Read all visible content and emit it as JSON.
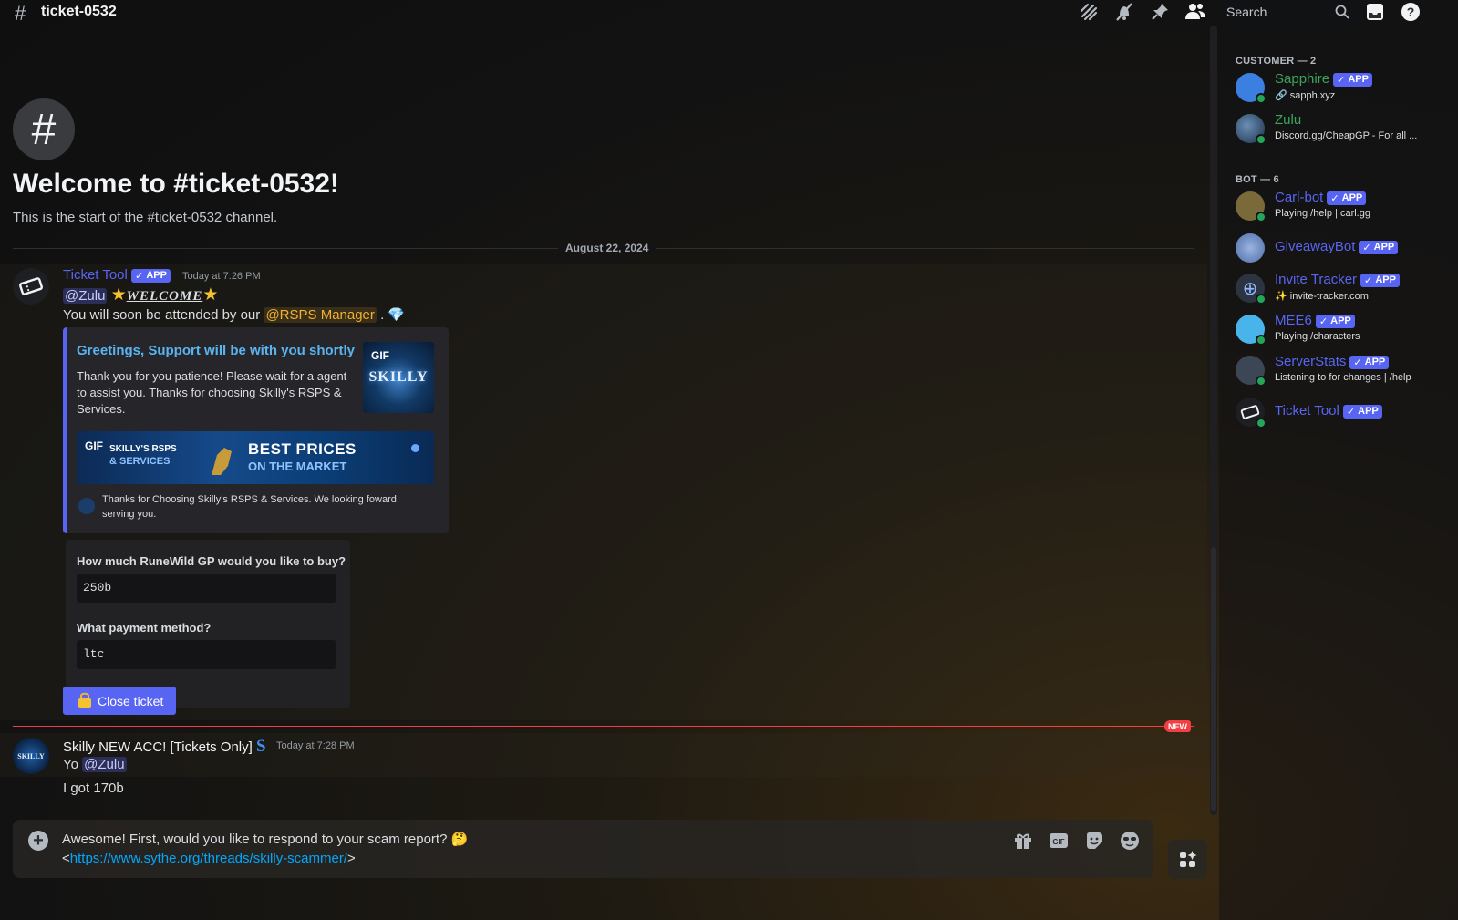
{
  "header": {
    "channel_name": "ticket-0532",
    "search_placeholder": "Search"
  },
  "intro": {
    "title": "Welcome to #ticket-0532!",
    "subtitle": "This is the start of the #ticket-0532 channel.",
    "date_divider": "August 22, 2024"
  },
  "message1": {
    "author": "Ticket Tool",
    "badge": "APP",
    "timestamp": "Today at 7:26 PM",
    "line1_mention": "@Zulu",
    "line1_welcome": "WELCOME",
    "line2_prefix": "You will soon be attended by our",
    "line2_role": "@RSPS Manager",
    "line2_suffix": ".",
    "embed": {
      "title": "Greetings, Support will be with you shortly",
      "description": "Thank you for you patience! Please wait for a agent to assist you. Thanks for choosing Skilly's RSPS & Services.",
      "thumb_gif_label": "GIF",
      "thumb_text": "SKILLY",
      "banner_gif_label": "GIF",
      "banner_left_line1": "SKILLY'S RSPS",
      "banner_left_line2": "& SERVICES",
      "banner_right_line1": "BEST PRICES",
      "banner_right_line2": "ON THE MARKET",
      "footer": "Thanks for Choosing Skilly's RSPS & Services. We looking foward serving you."
    },
    "form": {
      "q1": "How much RuneWild GP would you like to buy?",
      "a1": "250b",
      "q2": "What payment method?",
      "a2": "ltc"
    },
    "close_button": "Close ticket"
  },
  "new_badge": "NEW",
  "message2": {
    "author": "Skilly NEW ACC! [Tickets Only]",
    "timestamp": "Today at 7:28 PM",
    "line1_prefix": "Yo",
    "line1_mention": "@Zulu",
    "line2": "I got 170b",
    "avatar_text": "SKILLY"
  },
  "composer": {
    "line1": "Awesome! First, would you like to respond to your scam report? 🤔",
    "line2_prefix": "<",
    "line2_link": "https://www.sythe.org/threads/skilly-scammer/",
    "line2_suffix": ">"
  },
  "members": {
    "customer_title": "CUSTOMER — 2",
    "bot_title": "BOT — 6",
    "customers": [
      {
        "name": "Sapphire",
        "badge": "APP",
        "sub": "🔗 sapph.xyz",
        "color": "#3ba55c"
      },
      {
        "name": "Zulu",
        "badge": "",
        "sub": "Discord.gg/CheapGP - For all ...",
        "color": "#3ba55c"
      }
    ],
    "bots": [
      {
        "name": "Carl-bot",
        "badge": "APP",
        "sub": "Playing /help | carl.gg",
        "color": "#5865f2"
      },
      {
        "name": "GiveawayBot",
        "badge": "APP",
        "sub": "",
        "color": "#5865f2"
      },
      {
        "name": "Invite Tracker",
        "badge": "APP",
        "sub": "✨ invite-tracker.com",
        "color": "#5865f2"
      },
      {
        "name": "MEE6",
        "badge": "APP",
        "sub": "Playing /characters",
        "color": "#5865f2"
      },
      {
        "name": "ServerStats",
        "badge": "APP",
        "sub": "Listening to for changes | /help",
        "color": "#5865f2"
      },
      {
        "name": "Ticket Tool",
        "badge": "APP",
        "sub": "",
        "color": "#5865f2"
      }
    ]
  },
  "icons": {
    "threads": "threads-icon",
    "mute": "bell-slash-icon",
    "pin": "pin-icon",
    "members": "members-icon",
    "inbox": "inbox-icon",
    "help": "help-icon"
  }
}
